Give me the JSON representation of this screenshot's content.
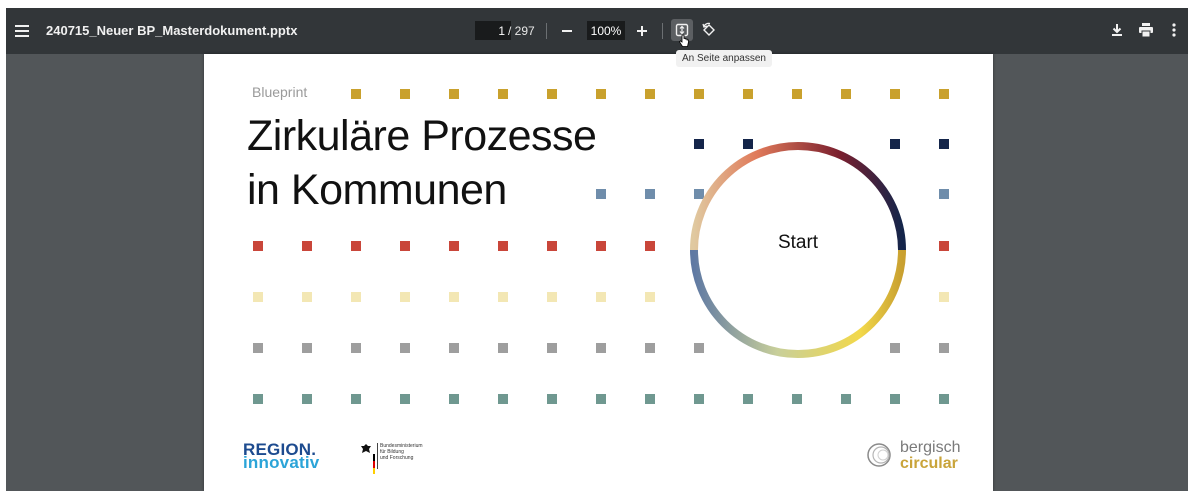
{
  "toolbar": {
    "title": "240715_Neuer BP_Masterdokument.pptx",
    "page_current": "1",
    "page_total": "/ 297",
    "zoom": "100%",
    "tooltip": "An Seite anpassen",
    "icons": [
      "menu-icon",
      "zoom-out-icon",
      "zoom-in-icon",
      "fit-page-icon",
      "rotate-icon",
      "download-icon",
      "print-icon",
      "more-vert-icon"
    ]
  },
  "slide": {
    "label": "Blueprint",
    "title_line1": "Zirkuläre Prozesse",
    "title_line2": "in Kommunen",
    "ring_label": "Start",
    "logo_region_top": "REGION.",
    "logo_region_bottom": "innovativ",
    "bmbf_text": [
      "Bundesministerium",
      "für Bildung",
      "und Forschung"
    ],
    "logo_bc_top": "bergisch",
    "logo_bc_bottom": "circular",
    "colors": {
      "gold": "#c9a12d",
      "navy": "#14254a",
      "steel": "#6f8dab",
      "red": "#c9463a",
      "cream": "#f3e7b4",
      "gray": "#9e9e9e",
      "teal": "#6f9890"
    }
  }
}
